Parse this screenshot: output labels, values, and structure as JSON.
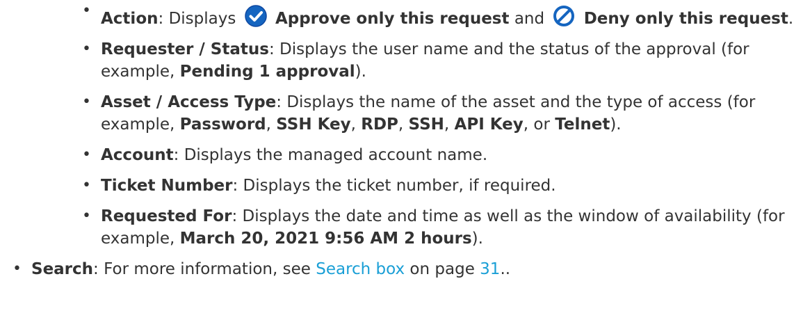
{
  "bullet_char": "•",
  "colors": {
    "text": "#333333",
    "link": "#1a9fd6",
    "icon_blue": "#1565c0"
  },
  "items": {
    "action": {
      "term": "Action",
      "sep": ": ",
      "text1": "Displays",
      "approve_icon": "check-circle-icon",
      "approve_label": "Approve only this request",
      "and": "and",
      "deny_icon": "prohibited-icon",
      "deny_label": "Deny only this request",
      "end": "."
    },
    "requester": {
      "term": "Requester / Status",
      "sep": ": ",
      "text": "Displays the user name and the status of the approval (for example, ",
      "example": "Pending 1 approval",
      "end": ")."
    },
    "asset": {
      "term": "Asset / Access Type",
      "sep": ": ",
      "text": "Displays the name of the asset and the type of access (for example, ",
      "ex1": "Password",
      "c1": ", ",
      "ex2": "SSH Key",
      "c2": ", ",
      "ex3": "RDP",
      "c3": ", ",
      "ex4": "SSH",
      "c4": ", ",
      "ex5": "API Key",
      "c5": ", or ",
      "ex6": "Telnet",
      "end": ")."
    },
    "account": {
      "term": "Account",
      "sep": ": ",
      "text": "Displays the managed account name."
    },
    "ticket": {
      "term": "Ticket Number",
      "sep": ": ",
      "text": "Displays the ticket number, if required."
    },
    "requested_for": {
      "term": "Requested For",
      "sep": ": ",
      "text": "Displays the date and time as well as the window of availability (for example, ",
      "example": "March 20, 2021 9:56 AM 2 hours",
      "end": ")."
    },
    "search": {
      "term": "Search",
      "sep": ": ",
      "text": "For more information, see ",
      "link_text": "Search box",
      "on_page": " on page ",
      "page_link": "31",
      "end": ".."
    }
  }
}
